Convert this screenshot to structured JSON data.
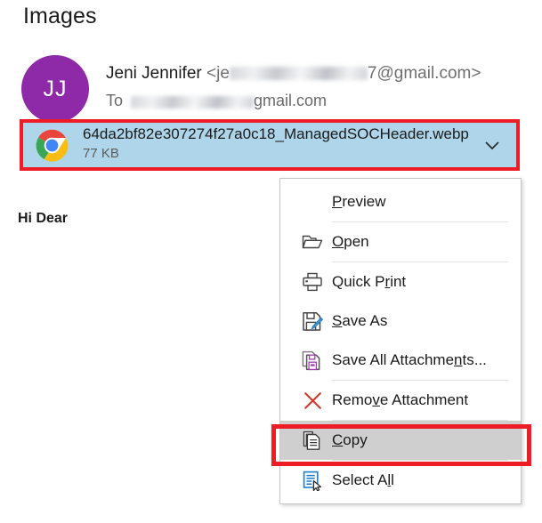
{
  "page": {
    "title": "Images",
    "body_greeting": "Hi Dear"
  },
  "message": {
    "avatar_initials": "JJ",
    "sender_name": "Jeni Jennifer",
    "sender_email_prefix": "<",
    "sender_email_visible_start": "je",
    "sender_email_visible_end": "7@gmail.com>",
    "recipient_label": "To",
    "recipient_visible_end": "gmail.com",
    "sender_email_redacted": true,
    "recipient_redacted": true
  },
  "attachment": {
    "filename": "64da2bf82e307274f27a0c18_ManagedSOCHeader.webp",
    "size": "77 KB",
    "icon": "chrome-icon",
    "expand_icon": "chevron-down-icon",
    "selected": true,
    "highlight_color": "#ee1c25",
    "chip_background": "#afd5ea"
  },
  "context_menu": {
    "highlight_color": "#ee1c25",
    "hover_background": "#cfcfcf",
    "items": [
      {
        "label_before": "",
        "accel": "P",
        "label_after": "review",
        "icon": "",
        "separator_after": true,
        "highlighted": false
      },
      {
        "label_before": "",
        "accel": "O",
        "label_after": "pen",
        "icon": "folder-open-icon",
        "separator_after": true,
        "highlighted": false
      },
      {
        "label_before": "Quick P",
        "accel": "r",
        "label_after": "int",
        "icon": "printer-icon",
        "separator_after": false,
        "highlighted": false
      },
      {
        "label_before": "",
        "accel": "S",
        "label_after": "ave As",
        "icon": "save-as-icon",
        "separator_after": false,
        "highlighted": false
      },
      {
        "label_before": "Save All Attachme",
        "accel": "n",
        "label_after": "ts...",
        "icon": "save-all-attachments-icon",
        "separator_after": true,
        "highlighted": false
      },
      {
        "label_before": "Remo",
        "accel": "v",
        "label_after": "e Attachment",
        "icon": "remove-attachment-icon",
        "separator_after": true,
        "highlighted": false
      },
      {
        "label_before": "",
        "accel": "C",
        "label_after": "opy",
        "icon": "copy-icon",
        "separator_after": true,
        "highlighted": true
      },
      {
        "label_before": "Select A",
        "accel": "l",
        "label_after": "l",
        "icon": "select-all-icon",
        "separator_after": false,
        "highlighted": false
      }
    ]
  }
}
